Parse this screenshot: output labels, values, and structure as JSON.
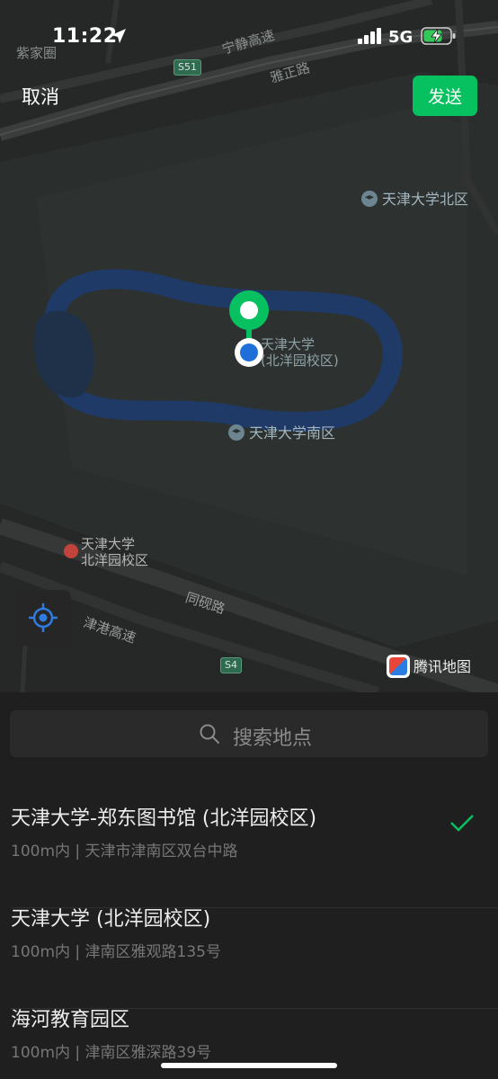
{
  "status_bar": {
    "time": "11:22",
    "network": "5G"
  },
  "header": {
    "cancel_label": "取消",
    "send_label": "发送"
  },
  "map": {
    "labels": {
      "top_left_area": "紫家圈",
      "highway_north": "宁静高速",
      "road_yazheng": "雅正路",
      "road_tongyan": "同砚路",
      "highway_jingang": "津港高速",
      "shield_s51": "S51",
      "shield_s4": "S4"
    },
    "pois": {
      "north_campus": "天津大学北区",
      "south_campus": "天津大学南区"
    },
    "campus_label": {
      "line1": "天津大学",
      "line2": "(北洋园校区)"
    },
    "metro_label": {
      "line1": "天津大学",
      "line2": "北洋园校区"
    },
    "provider_logo": "腾讯地图"
  },
  "search": {
    "placeholder": "搜索地点"
  },
  "results": [
    {
      "title": "天津大学-郑东图书馆 (北洋园校区)",
      "subtitle": "100m内 | 天津市津南区双台中路",
      "selected": true
    },
    {
      "title": "天津大学 (北洋园校区)",
      "subtitle": "100m内 | 津南区雅观路135号",
      "selected": false
    },
    {
      "title": "海河教育园区",
      "subtitle": "100m内 | 津南区雅深路39号",
      "selected": false
    }
  ],
  "colors": {
    "accent": "#07c160",
    "pin_blue": "#1e6fd9",
    "map_bg": "#252827",
    "water": "#1f3148"
  }
}
